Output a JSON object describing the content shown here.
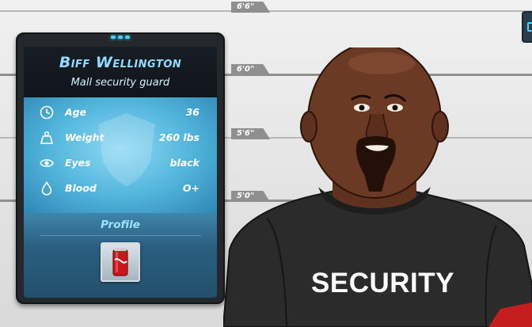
{
  "lineup": {
    "height_marks": [
      "6'6\"",
      "6'0\"",
      "5'6\"",
      "5'0\""
    ]
  },
  "card": {
    "name": "Biff Wellington",
    "occupation": "Mall security guard",
    "stats": [
      {
        "icon": "clock-icon",
        "label": "Age",
        "value": "36"
      },
      {
        "icon": "weight-icon",
        "label": "Weight",
        "value": "260 lbs"
      },
      {
        "icon": "eye-icon",
        "label": "Eyes",
        "value": "black"
      },
      {
        "icon": "blood-drop-icon",
        "label": "Blood",
        "value": "O+"
      }
    ],
    "profile_heading": "Profile",
    "profile_clue_icon": "soda-can-icon"
  },
  "suspect": {
    "shirt_text": "SECURITY"
  },
  "colors": {
    "accent": "#8fdcff",
    "panel_blue": "#4fb3da",
    "skin": "#6b3a24",
    "shirt": "#2a2a2a"
  }
}
